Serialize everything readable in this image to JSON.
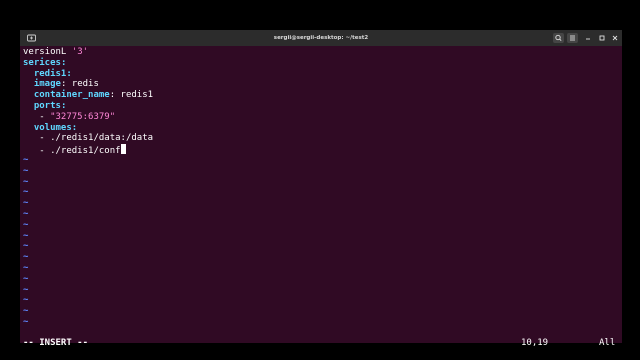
{
  "window": {
    "title": "sergii@sergii-desktop: ~/test2"
  },
  "icons": {
    "new_tab": "new-tab-icon",
    "search": "search-icon",
    "menu": "hamburger-menu-icon",
    "minimize": "minimize-icon",
    "maximize": "maximize-icon",
    "close": "close-icon"
  },
  "colors": {
    "background": "#300a24",
    "titlebar": "#2c2c2c",
    "yaml_key": "#5fd7ff",
    "string": "#ff87d7",
    "tilde": "#5f87ff"
  },
  "editor": {
    "lines": [
      [
        {
          "t": "versionL ",
          "c": "plain"
        },
        {
          "t": "'3'",
          "c": "str"
        }
      ],
      [
        {
          "t": "serices",
          "c": "key"
        },
        {
          "t": ":",
          "c": "key"
        }
      ],
      [
        {
          "t": "  redis1",
          "c": "key"
        },
        {
          "t": ":",
          "c": "key"
        }
      ],
      [
        {
          "t": "  image",
          "c": "key"
        },
        {
          "t": ": redis",
          "c": "plain"
        }
      ],
      [
        {
          "t": "  container_name",
          "c": "key"
        },
        {
          "t": ": redis1",
          "c": "plain"
        }
      ],
      [
        {
          "t": "  ports",
          "c": "key"
        },
        {
          "t": ":",
          "c": "key"
        }
      ],
      [
        {
          "t": "   - ",
          "c": "plain"
        },
        {
          "t": "\"32775:6379\"",
          "c": "str"
        }
      ],
      [
        {
          "t": "  volumes",
          "c": "key"
        },
        {
          "t": ":",
          "c": "key"
        }
      ],
      [
        {
          "t": "   - ./redis1/data:/data",
          "c": "plain"
        }
      ],
      [
        {
          "t": "   - ./redis1/conf",
          "c": "plain"
        }
      ]
    ],
    "cursor_line": 9,
    "tilde_char": "~",
    "tilde_count": 16
  },
  "status": {
    "mode": "-- INSERT --",
    "position": "10,19",
    "scroll": "All"
  }
}
